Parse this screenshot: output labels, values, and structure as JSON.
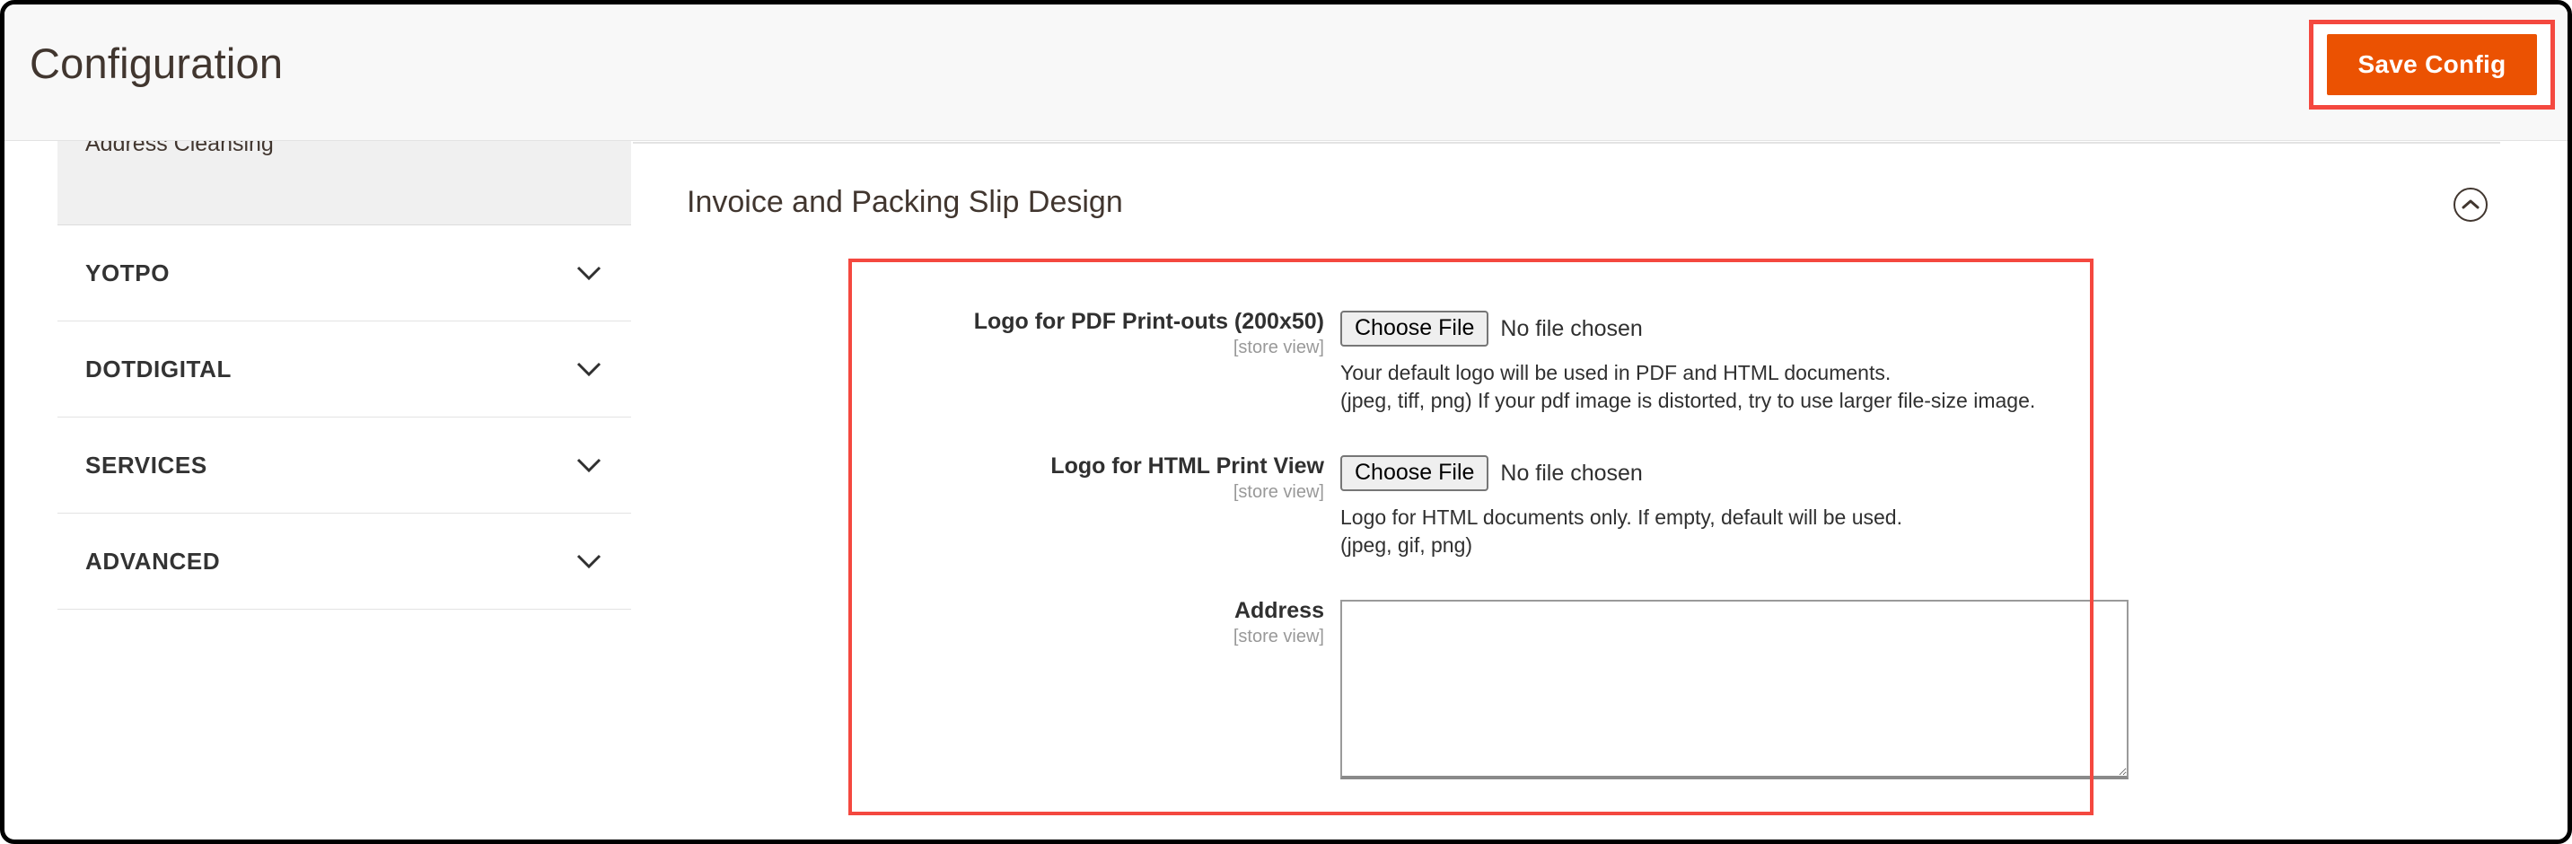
{
  "header": {
    "title": "Configuration",
    "save_label": "Save Config"
  },
  "sidebar": {
    "items": [
      {
        "label": "Address Cleansing",
        "icon": "none",
        "partial": true
      },
      {
        "label": "YOTPO",
        "icon": "chevron-down-icon",
        "partial": false
      },
      {
        "label": "DOTDIGITAL",
        "icon": "chevron-down-icon",
        "partial": false
      },
      {
        "label": "SERVICES",
        "icon": "chevron-down-icon",
        "partial": false
      },
      {
        "label": "ADVANCED",
        "icon": "chevron-down-icon",
        "partial": false
      }
    ]
  },
  "main": {
    "section_title": "Invoice and Packing Slip Design",
    "collapse_icon": "chevron-up-circle-icon",
    "fields": {
      "pdf_logo": {
        "label": "Logo for PDF Print-outs (200x50)",
        "scope": "[store view]",
        "button_label": "Choose File",
        "file_status": "No file chosen",
        "note_line_1": "Your default logo will be used in PDF and HTML documents.",
        "note_line_2": "(jpeg, tiff, png) If your pdf image is distorted, try to use larger file-size image."
      },
      "html_logo": {
        "label": "Logo for HTML Print View",
        "scope": "[store view]",
        "button_label": "Choose File",
        "file_status": "No file chosen",
        "note_line_1": "Logo for HTML documents only. If empty, default will be used.",
        "note_line_2": "(jpeg, gif, png)"
      },
      "address": {
        "label": "Address",
        "scope": "[store view]",
        "value": "",
        "placeholder": ""
      }
    }
  },
  "colors": {
    "accent_orange": "#eb5202",
    "annotation_red": "#f4483f",
    "header_bg": "#f8f8f8",
    "text_dark": "#41362f",
    "muted": "#999999"
  }
}
